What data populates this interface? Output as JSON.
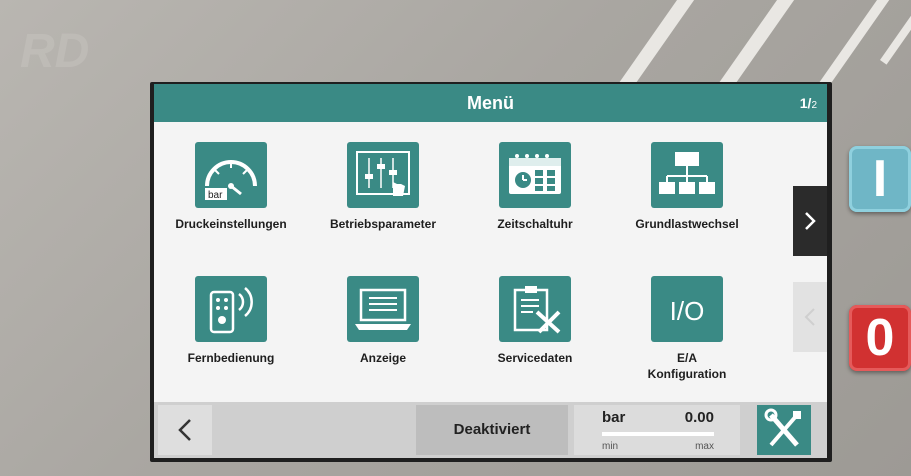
{
  "header": {
    "title": "Menü",
    "page_current": "1/",
    "page_total": "2"
  },
  "menu_items": [
    {
      "label": "Druckeinstellungen",
      "icon": "pressure-gauge-icon"
    },
    {
      "label": "Betriebsparameter",
      "icon": "slider-settings-icon"
    },
    {
      "label": "Zeitschaltuhr",
      "icon": "timer-calendar-icon"
    },
    {
      "label": "Grundlastwechsel",
      "icon": "network-hierarchy-icon"
    },
    {
      "label": "Fernbedienung",
      "icon": "remote-control-icon"
    },
    {
      "label": "Anzeige",
      "icon": "laptop-display-icon"
    },
    {
      "label": "Servicedaten",
      "icon": "clipboard-tools-icon"
    },
    {
      "label": "E/A\nKonfiguration",
      "icon": "io-icon"
    }
  ],
  "gauge_icon_text": "bar",
  "io_icon_text": "I/O",
  "footer": {
    "status": "Deaktiviert",
    "unit": "bar",
    "value": "0.00",
    "min_label": "min",
    "max_label": "max"
  },
  "hardware": {
    "on_label": "I",
    "off_label": "0"
  },
  "colors": {
    "accent": "#3a8a85",
    "on_button": "#6fb6c6",
    "off_button": "#d13131"
  }
}
